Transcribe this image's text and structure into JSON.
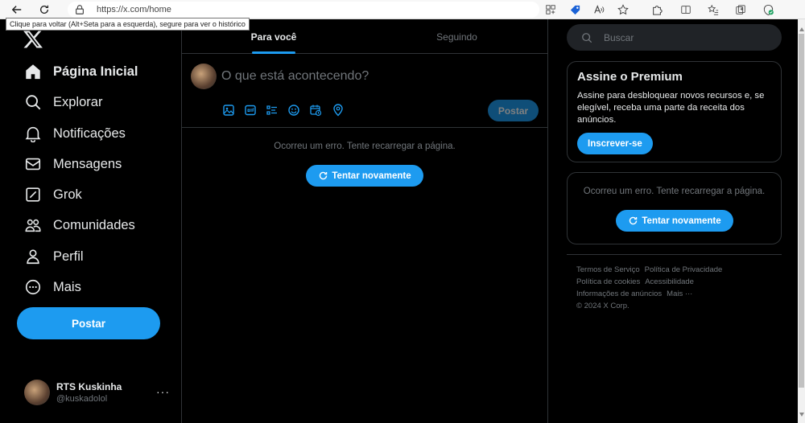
{
  "browser": {
    "url": "https://x.com/home",
    "tooltip": "Clique para voltar (Alt+Seta para a esquerda), segure para ver o histórico"
  },
  "sidebar": {
    "items": [
      {
        "label": "Página Inicial",
        "icon": "home-icon"
      },
      {
        "label": "Explorar",
        "icon": "search-icon"
      },
      {
        "label": "Notificações",
        "icon": "bell-icon"
      },
      {
        "label": "Mensagens",
        "icon": "mail-icon"
      },
      {
        "label": "Grok",
        "icon": "grok-icon"
      },
      {
        "label": "Comunidades",
        "icon": "people-icon"
      },
      {
        "label": "Perfil",
        "icon": "person-icon"
      },
      {
        "label": "Mais",
        "icon": "more-circle-icon"
      }
    ],
    "post_label": "Postar",
    "account": {
      "name": "RTS Kuskinha",
      "handle": "@kuskadolol",
      "more": "···"
    }
  },
  "main": {
    "tabs": [
      {
        "label": "Para você",
        "active": true
      },
      {
        "label": "Seguindo",
        "active": false
      }
    ],
    "composer": {
      "placeholder": "O que está acontecendo?",
      "post_label": "Postar"
    },
    "error": {
      "message": "Ocorreu um erro. Tente recarregar a página.",
      "retry_label": "Tentar novamente"
    }
  },
  "right": {
    "search_placeholder": "Buscar",
    "premium": {
      "title": "Assine o Premium",
      "description": "Assine para desbloquear novos recursos e, se elegível, receba uma parte da receita dos anúncios.",
      "button": "Inscrever-se"
    },
    "error": {
      "message": "Ocorreu um erro. Tente recarregar a página.",
      "retry_label": "Tentar novamente"
    },
    "footer": {
      "links": [
        "Termos de Serviço",
        "Política de Privacidade",
        "Política de cookies",
        "Acessibilidade",
        "Informações de anúncios",
        "Mais ···"
      ],
      "copyright": "© 2024 X Corp."
    }
  },
  "colors": {
    "accent": "#1d9bf0",
    "background": "#000000",
    "border": "#2f3336",
    "muted": "#71767b"
  }
}
